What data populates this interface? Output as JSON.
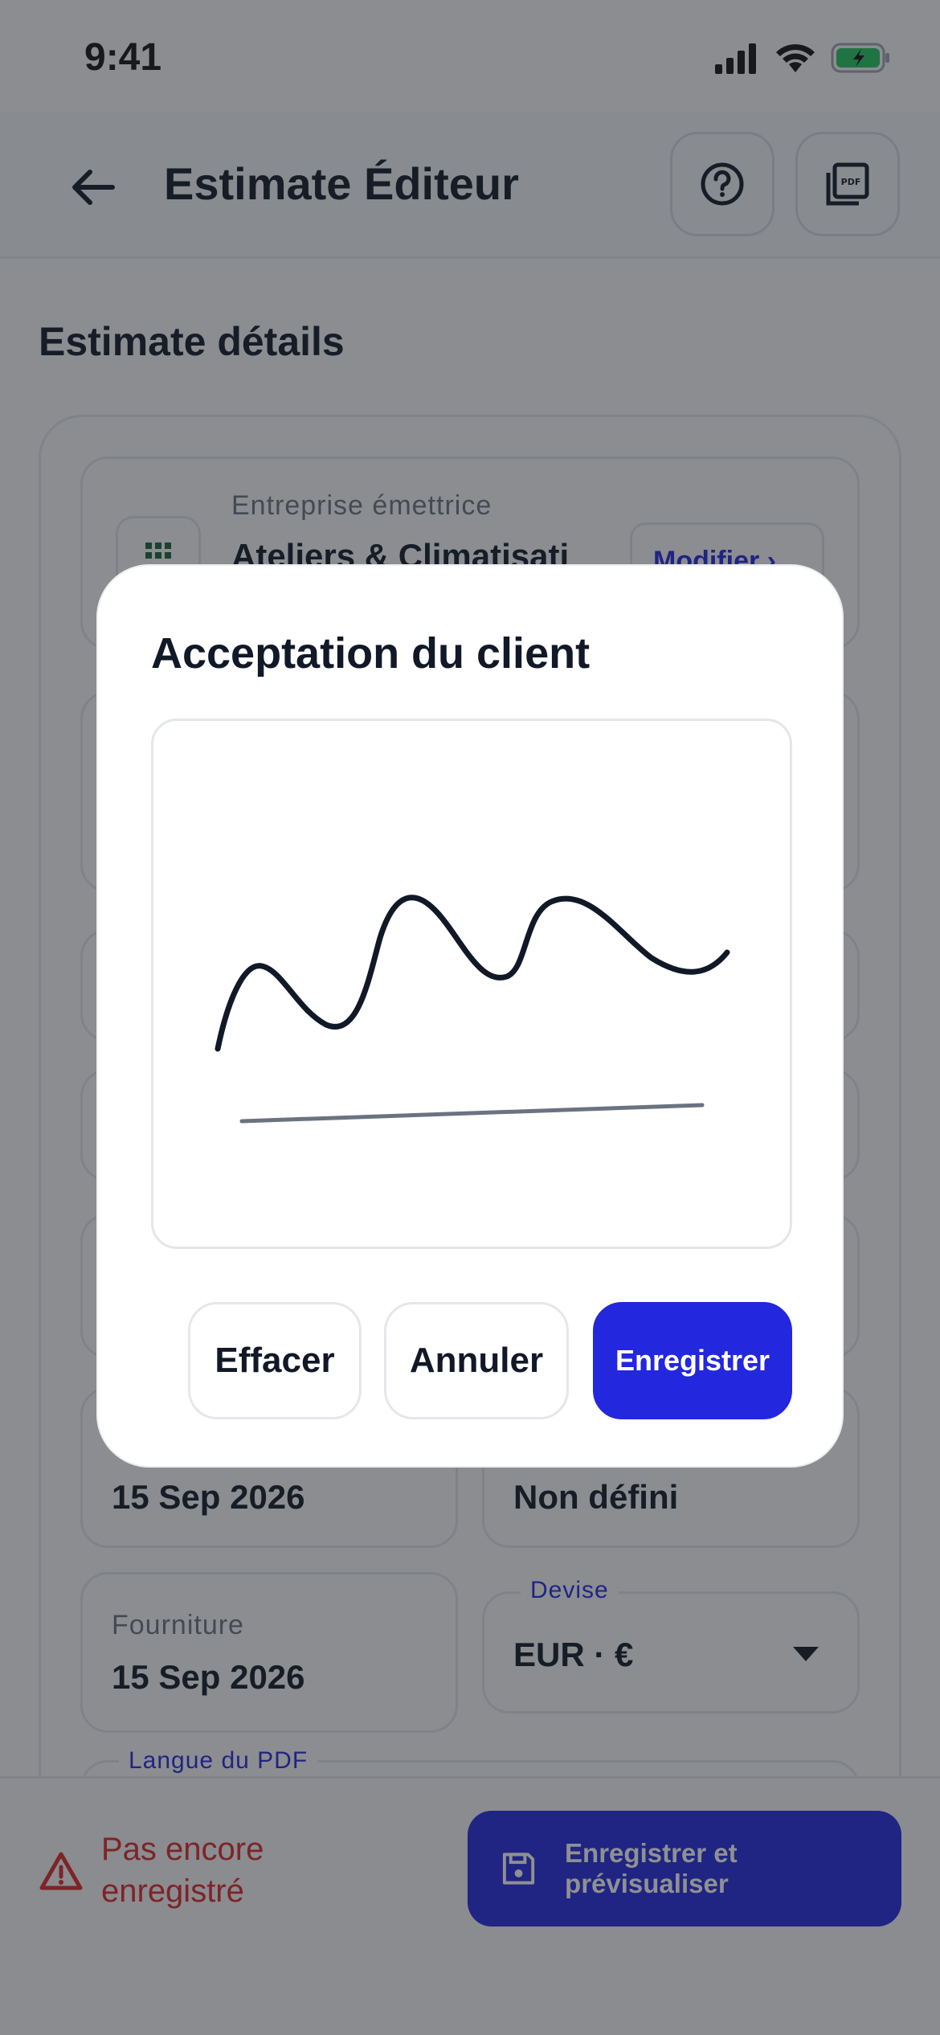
{
  "status_bar": {
    "time": "9:41"
  },
  "header": {
    "title": "Estimate Éditeur"
  },
  "section": {
    "title": "Estimate détails"
  },
  "company": {
    "label": "Entreprise émettrice",
    "value": "Ateliers & Climatisati",
    "modify": "Modifier"
  },
  "fields": {
    "date_left_value": "15 Sep 2026",
    "date_right_value": "Non défini",
    "fourniture_label": "Fourniture",
    "fourniture_value": "15 Sep 2026",
    "currency_label": "Devise",
    "currency_value": "EUR · €",
    "pdf_lang_label": "Langue du PDF"
  },
  "bottom": {
    "warning": "Pas encore enregistré",
    "save_preview": "Enregistrer et prévisualiser"
  },
  "dialog": {
    "title": "Acceptation du client",
    "clear": "Effacer",
    "cancel": "Annuler",
    "save": "Enregistrer"
  },
  "colors": {
    "accent": "#2327dd",
    "warning": "#dc2626",
    "battery": "#22c55e"
  }
}
